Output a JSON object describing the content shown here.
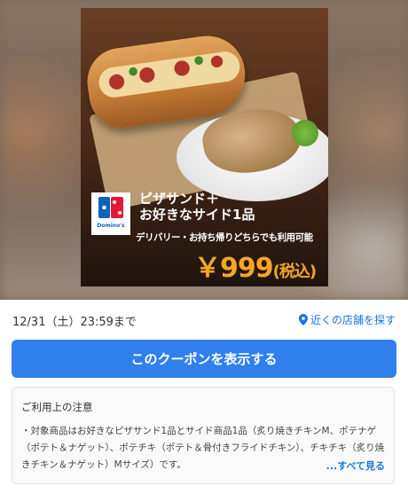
{
  "coupon": {
    "title_line1": "ピザサンド＋",
    "title_line2": "お好きなサイド1品",
    "subtitle": "デリバリー・お持ち帰りどちらでも利用可能",
    "price": "￥999",
    "tax_label": "(税込)",
    "brand": "Domino's"
  },
  "meta": {
    "expiry": "12/31（土）23:59まで",
    "store_link": "近くの店舗を探す"
  },
  "cta": {
    "label": "このクーポンを表示する"
  },
  "notes": {
    "heading": "ご利用上の注意",
    "body": "・対象商品はお好きなピザサンド1品とサイド商品1品（炙り焼きチキンM、ポテナゲ（ポテト＆ナゲット）、ポテチキ（ポテト＆骨付きフライドチキン）、チキチキ（炙り焼きチキン＆ナゲット）Mサイズ）です。",
    "see_all": "...すべて見る"
  },
  "colors": {
    "accent_blue": "#2f80ed",
    "price_orange": "#f5a623",
    "link_blue": "#1a73e8"
  }
}
